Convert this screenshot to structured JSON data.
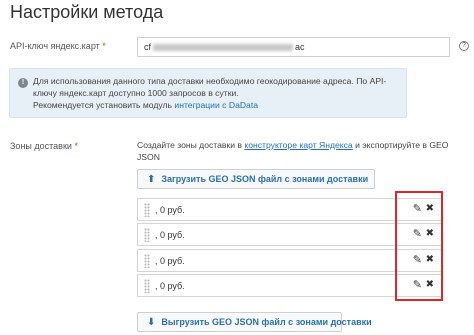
{
  "page": {
    "title": "Настройки метода"
  },
  "api_key": {
    "label": "API-ключ яндекс.карт",
    "required_mark": "*",
    "value_prefix": "cf",
    "value_suffix": "ac",
    "help": "?"
  },
  "info": {
    "icon": "!",
    "text_main": "Для использования данного типа доставки необходимо геокодирование адреса. По API-ключу яндекс.карт доступно 1000 запросов в сутки.",
    "text_reco": "Рекомендуется установить модуль ",
    "link": "интеграции с DaData"
  },
  "zones": {
    "label": "Зоны доставки",
    "required_mark": "*",
    "desc_before": "Создайте зоны доставки в ",
    "desc_link": "конструкторе карт Яндекса",
    "desc_after": " и экспортируйте в GEO JSON",
    "upload_label": "Загрузить GEO JSON файл с зонами доставки",
    "download_label": "Выгрузить GEO JSON файл с зонами доставки",
    "rows": [
      {
        "text": ", 0 руб."
      },
      {
        "text": ", 0 руб."
      },
      {
        "text": ", 0 руб."
      },
      {
        "text": ", 0 руб."
      }
    ]
  },
  "icons": {
    "edit": "✎",
    "delete": "✖",
    "upload": "⬆",
    "download": "⬇"
  },
  "colors": {
    "link": "#1e6fb9",
    "highlight": "#e0262b",
    "info_bg": "#e8f0f7"
  }
}
